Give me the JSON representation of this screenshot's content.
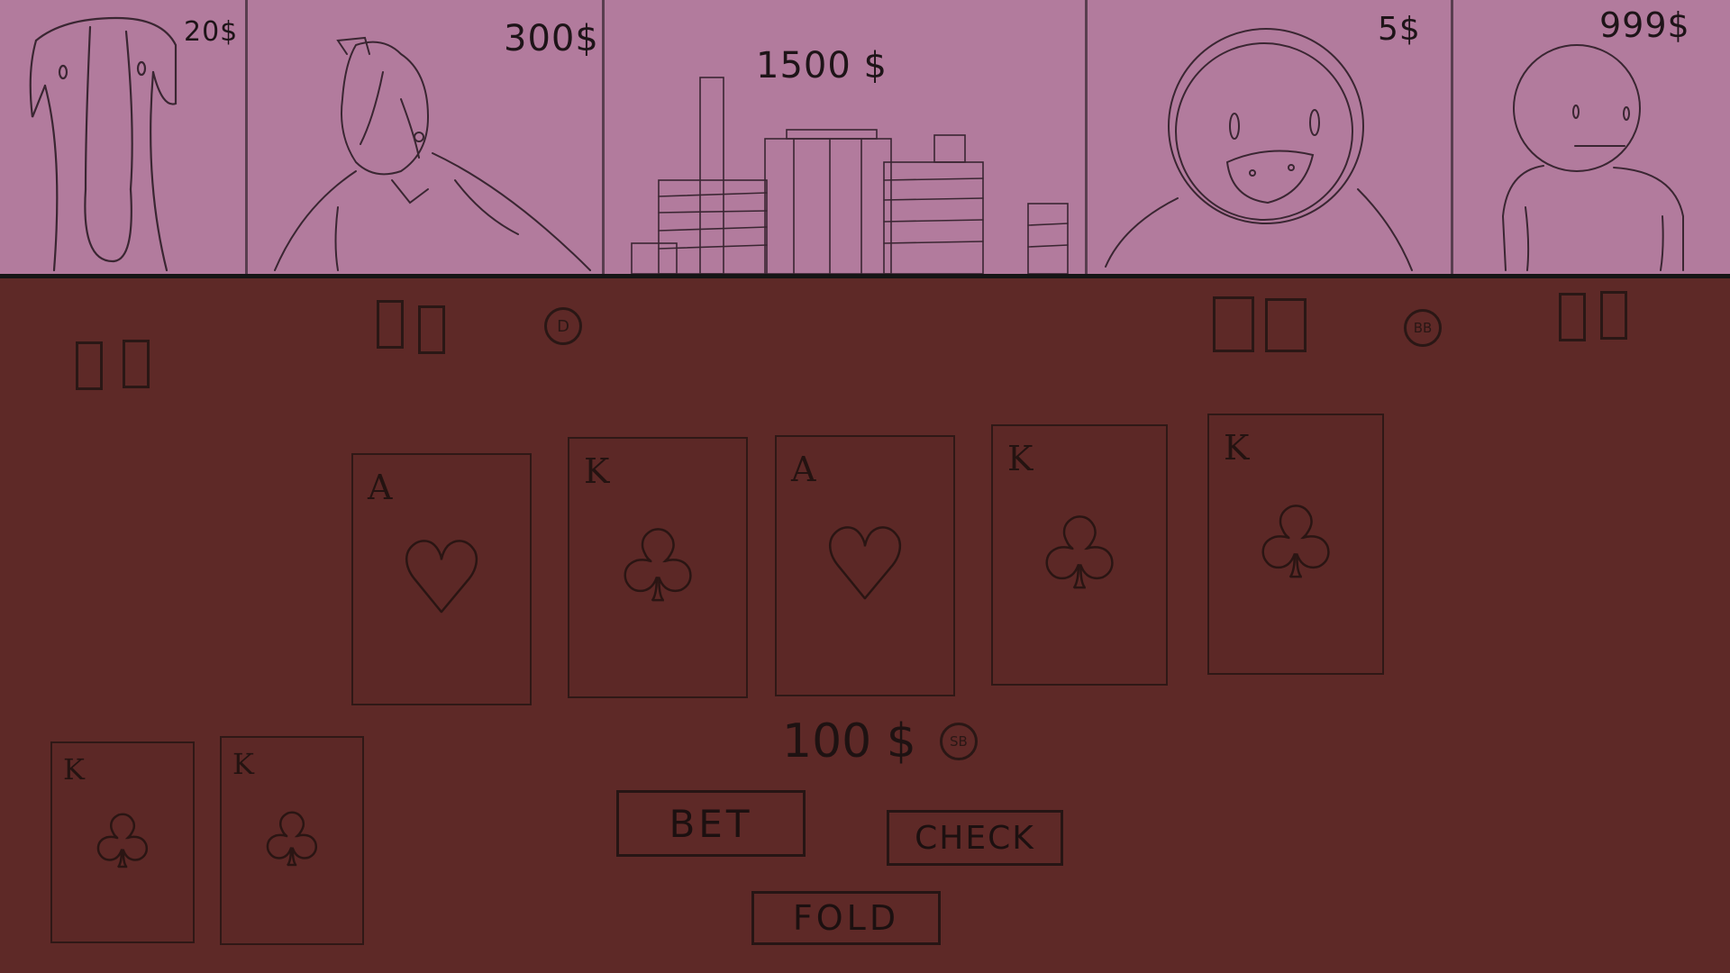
{
  "opponents": [
    {
      "name_icon": "dog-portrait-icon",
      "money": "20$"
    },
    {
      "name_icon": "girl-portrait-icon",
      "money": "300$"
    },
    {
      "name_icon": "city-skyline-icon",
      "money": "1500 $"
    },
    {
      "name_icon": "duck-portrait-icon",
      "money": "5$"
    },
    {
      "name_icon": "stick-figure-portrait-icon",
      "money": "999$"
    }
  ],
  "chips": {
    "dealer": "D",
    "big_blind": "BB",
    "small_blind": "SB"
  },
  "community_cards": [
    {
      "rank": "A",
      "suit": "♥"
    },
    {
      "rank": "K",
      "suit": "♣"
    },
    {
      "rank": "A",
      "suit": "♥"
    },
    {
      "rank": "K",
      "suit": "♣"
    },
    {
      "rank": "K",
      "suit": "♣"
    }
  ],
  "player_hand": [
    {
      "rank": "K",
      "suit": "♣"
    },
    {
      "rank": "K",
      "suit": "♣"
    }
  ],
  "pot": {
    "amount": "100 $"
  },
  "actions": {
    "bet": "BET",
    "check": "CHECK",
    "fold": "FOLD"
  },
  "colors": {
    "top_strip": "#b27b9d",
    "table": "#5e2927",
    "line": "#2a1715"
  }
}
